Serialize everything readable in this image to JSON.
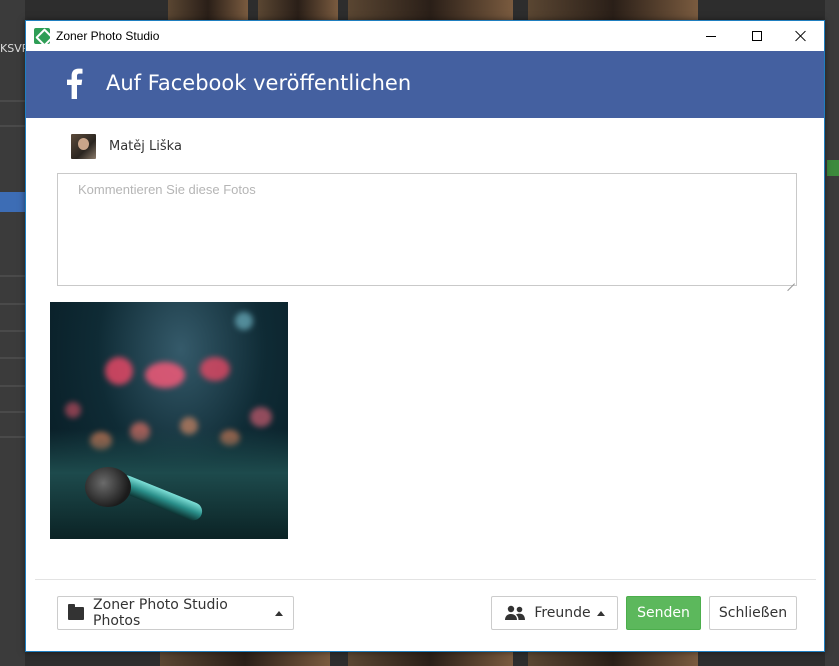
{
  "window": {
    "title": "Zoner Photo Studio"
  },
  "header": {
    "title": "Auf Facebook veröffentlichen"
  },
  "user": {
    "name": "Matěj Liška"
  },
  "comment": {
    "placeholder": "Kommentieren Sie diese Fotos",
    "value": ""
  },
  "photo": {
    "subject": "microphone"
  },
  "footer": {
    "album_label": "Zoner Photo Studio Photos",
    "audience_label": "Freunde",
    "send_label": "Senden",
    "close_label": "Schließen"
  },
  "background": {
    "left_text": "KSVR"
  },
  "colors": {
    "facebook_blue": "#4460a0",
    "send_green": "#5cb85c",
    "window_border": "#1f7fc0"
  },
  "icons": {
    "app": "zoner-app-icon",
    "facebook": "facebook-f-icon",
    "folder": "folder-icon",
    "friends": "friends-icon",
    "caret": "caret-up-icon"
  }
}
